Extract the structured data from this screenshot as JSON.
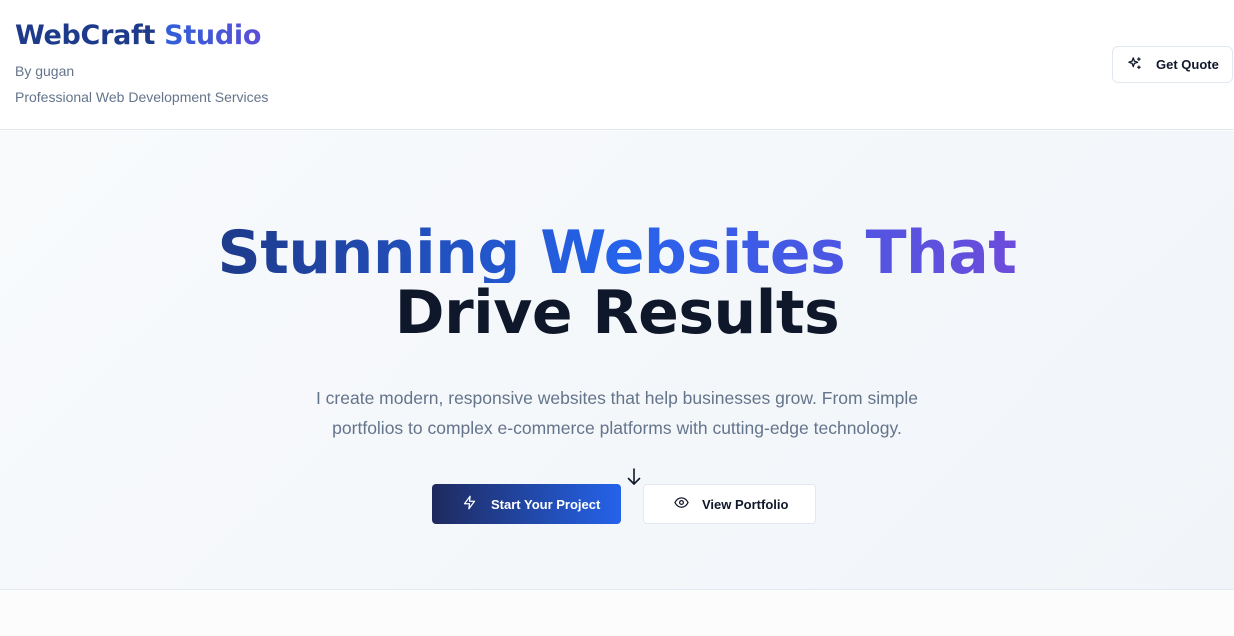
{
  "header": {
    "brand_part1": "WebCraft",
    "brand_part2": "Studio",
    "byline": "By gugan",
    "tagline": "Professional Web Development Services",
    "quote_button": {
      "label": "Get Quote",
      "icon": "sparkles-icon"
    }
  },
  "hero": {
    "headline_line1": "Stunning Websites That",
    "headline_line2": "Drive Results",
    "subtext_line1": "I create modern, responsive websites that help businesses grow. From simple",
    "subtext_line2": "portfolios to complex e-commerce platforms with cutting-edge technology.",
    "scroll_icon": "arrow-down-icon",
    "primary_button": {
      "label": "Start Your Project",
      "icon": "lightning-icon"
    },
    "secondary_button": {
      "label": "View Portfolio",
      "icon": "eye-icon"
    }
  },
  "colors": {
    "navy": "#1e3a8a",
    "blue": "#2563eb",
    "purple": "#6d4cdb",
    "text_dark": "#0f172a",
    "text_muted": "#64748b",
    "border": "#e2e8f0"
  }
}
